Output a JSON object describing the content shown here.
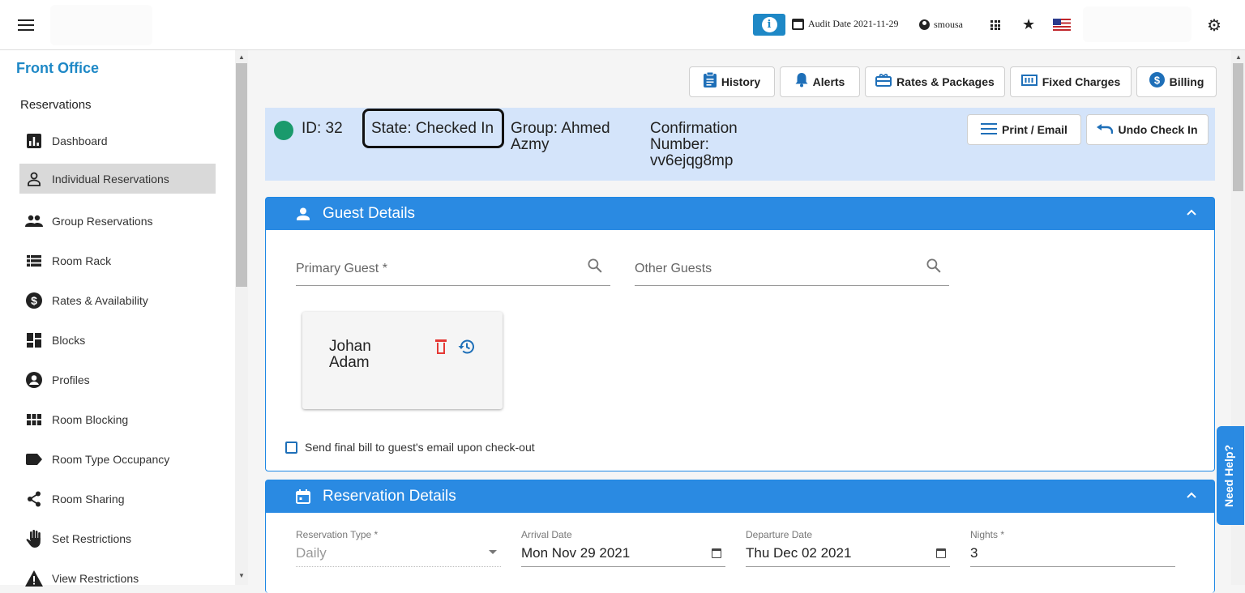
{
  "topbar": {
    "info_glyph": "i",
    "audit_date": "Audit Date 2021-11-29",
    "username": "smousa"
  },
  "sidebar": {
    "title": "Front Office",
    "section": "Reservations",
    "items": [
      {
        "label": "Dashboard",
        "icon": "bar-chart-icon"
      },
      {
        "label": "Individual Reservations",
        "icon": "person-icon",
        "active": true
      },
      {
        "label": "Group Reservations",
        "icon": "group-icon"
      },
      {
        "label": "Room Rack",
        "icon": "list-icon"
      },
      {
        "label": "Rates & Availability",
        "icon": "dollar-icon"
      },
      {
        "label": "Blocks",
        "icon": "dashboard-icon"
      },
      {
        "label": "Profiles",
        "icon": "account-circle-icon"
      },
      {
        "label": "Room Blocking",
        "icon": "grid-icon"
      },
      {
        "label": "Room Type Occupancy",
        "icon": "label-icon"
      },
      {
        "label": "Room Sharing",
        "icon": "share-icon"
      },
      {
        "label": "Set Restrictions",
        "icon": "hand-icon"
      },
      {
        "label": "View Restrictions",
        "icon": "warning-icon"
      }
    ]
  },
  "toolbar": {
    "history": "History",
    "alerts": "Alerts",
    "rates_packages": "Rates & Packages",
    "fixed_charges": "Fixed Charges",
    "billing": "Billing"
  },
  "status": {
    "id": "ID: 32",
    "state": "State: Checked In",
    "group": "Group: Ahmed Azmy",
    "confirmation": "Confirmation Number: vv6ejqg8mp",
    "print_email": "Print / Email",
    "undo_check_in": "Undo Check In",
    "status_color": "#1a9a6c"
  },
  "guest_details": {
    "title": "Guest Details",
    "primary_guest_placeholder": "Primary Guest *",
    "other_guests_placeholder": "Other Guests",
    "guest_name": "Johan Adam",
    "send_bill_label": "Send final bill to guest's email upon check-out"
  },
  "reservation_details": {
    "title": "Reservation Details",
    "reservation_type_label": "Reservation Type *",
    "reservation_type_value": "Daily",
    "arrival_label": "Arrival Date",
    "arrival_value": "Mon Nov 29 2021",
    "departure_label": "Departure Date",
    "departure_value": "Thu Dec 02 2021",
    "nights_label": "Nights *",
    "nights_value": "3"
  },
  "help": {
    "label": "Need Help?"
  },
  "colors": {
    "accent": "#2a8ae2",
    "brand": "#1e88c6",
    "status_bg": "#d4e4fa"
  }
}
